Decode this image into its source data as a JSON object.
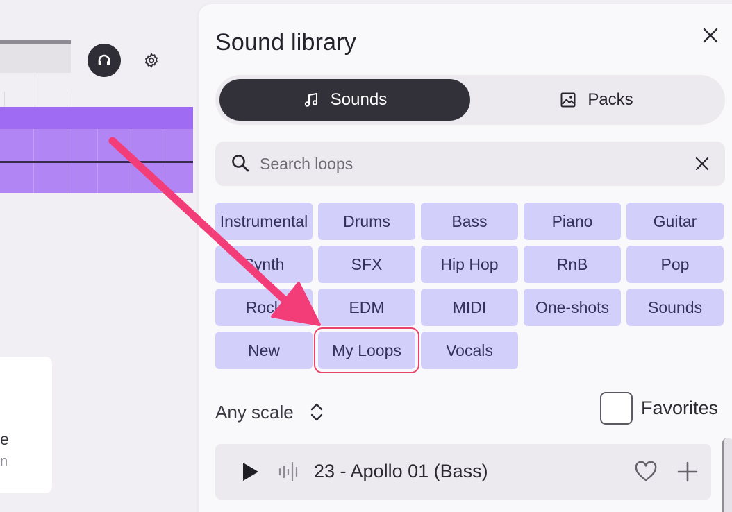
{
  "panel": {
    "title": "Sound library",
    "tabs": [
      {
        "label": "Sounds",
        "icon": "music-note-icon",
        "active": true
      },
      {
        "label": "Packs",
        "icon": "image-icon",
        "active": false
      }
    ],
    "search": {
      "placeholder": "Search loops",
      "value": ""
    },
    "categories": [
      "Instrumental",
      "Drums",
      "Bass",
      "Piano",
      "Guitar",
      "Synth",
      "SFX",
      "Hip Hop",
      "RnB",
      "Pop",
      "Rock",
      "EDM",
      "MIDI",
      "One-shots",
      "Sounds",
      "New",
      "My Loops",
      "Vocals"
    ],
    "highlighted_category": "My Loops",
    "scale_filter": {
      "label": "Any scale"
    },
    "favorites": {
      "label": "Favorites",
      "checked": false
    },
    "loops": [
      {
        "title": "23 - Apollo 01 (Bass)"
      }
    ]
  },
  "workspace": {
    "side_card_text": "e",
    "side_card_text2": "n"
  },
  "colors": {
    "accent_purple": "#b285f5",
    "chip_bg": "#d2cffa",
    "active_tab": "#323139",
    "annotation": "#f23d78"
  }
}
